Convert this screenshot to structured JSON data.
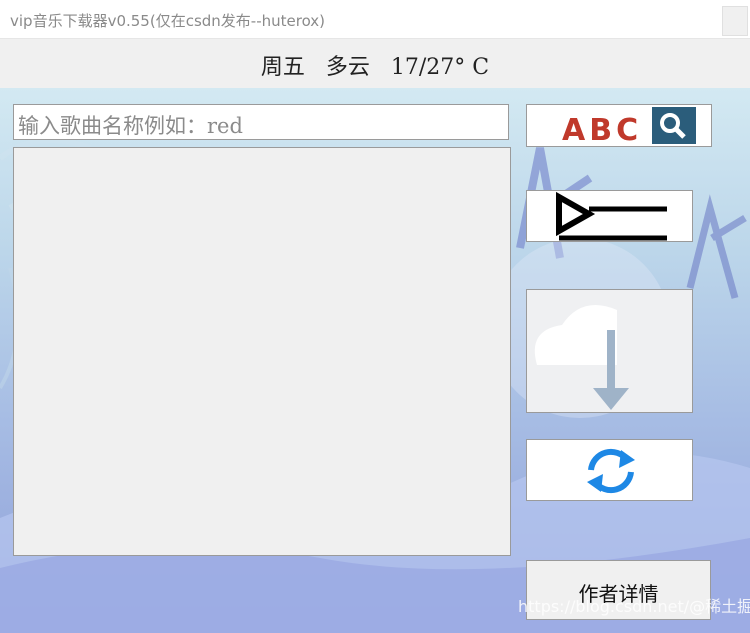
{
  "window": {
    "title": "vip音乐下载器v0.55(仅在csdn发布--huterox)"
  },
  "weather": {
    "text": "周五   多云   17/27° C"
  },
  "search": {
    "placeholder": "输入歌曲名称例如：red"
  },
  "buttons": {
    "search_icon": "abc-search-icon",
    "play_icon": "play-list-icon",
    "download_icon": "cloud-download-icon",
    "refresh_icon": "refresh-icon",
    "author_label": "作者详情"
  },
  "search_icon_text": "ABC",
  "watermark": "https://blog.csdn.net/@稀土掘金技术社区",
  "colors": {
    "abc_red": "#c0392b",
    "search_bg": "#2b5d7b",
    "refresh_blue": "#1e88e5",
    "download_arrow": "#9fb3c8"
  }
}
